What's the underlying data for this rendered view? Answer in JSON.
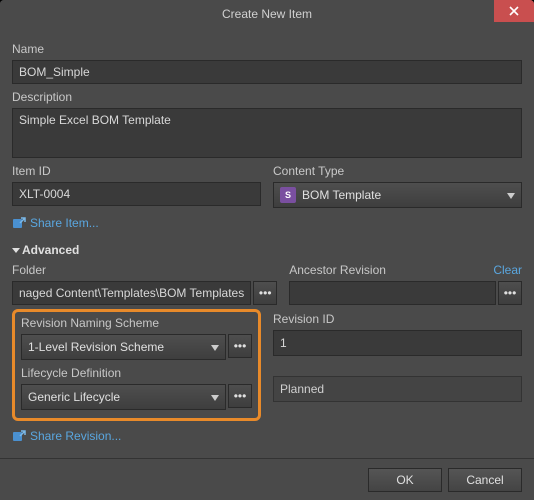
{
  "dialog": {
    "title": "Create New Item"
  },
  "name": {
    "label": "Name",
    "value": "BOM_Simple"
  },
  "description": {
    "label": "Description",
    "value": "Simple Excel BOM Template"
  },
  "itemId": {
    "label": "Item ID",
    "value": "XLT-0004"
  },
  "contentType": {
    "label": "Content Type",
    "value": "BOM Template"
  },
  "shareItem": {
    "label": "Share Item..."
  },
  "advanced": {
    "label": "Advanced"
  },
  "folder": {
    "label": "Folder",
    "value": "naged Content\\Templates\\BOM Templates"
  },
  "ancestor": {
    "label": "Ancestor Revision",
    "clear": "Clear",
    "value": ""
  },
  "revScheme": {
    "label": "Revision Naming Scheme",
    "value": "1-Level Revision Scheme"
  },
  "revId": {
    "label": "Revision ID",
    "value": "1"
  },
  "lifecycle": {
    "label": "Lifecycle Definition",
    "value": "Generic Lifecycle"
  },
  "state": {
    "value": "Planned"
  },
  "shareRevision": {
    "label": "Share Revision..."
  },
  "buttons": {
    "ok": "OK",
    "cancel": "Cancel"
  },
  "ellipsis": "•••"
}
